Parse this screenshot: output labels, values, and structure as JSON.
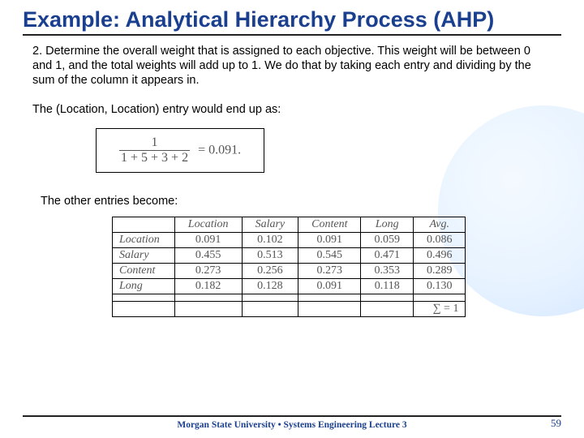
{
  "title": "Example: Analytical Hierarchy Process (AHP)",
  "para1": "2. Determine the overall weight that is assigned to each objective. This weight will be between 0 and 1, and the total weights will add up to 1. We do that by taking each entry and dividing by the sum of the column it appears in.",
  "para2": "The (Location, Location) entry would end up as:",
  "formula": {
    "numerator": "1",
    "denominator": "1 + 5 + 3 + 2",
    "rhs": "= 0.091."
  },
  "para3": "The other entries become:",
  "table": {
    "headers": [
      "",
      "Location",
      "Salary",
      "Content",
      "Long",
      "Avg."
    ],
    "rows": [
      [
        "Location",
        "0.091",
        "0.102",
        "0.091",
        "0.059",
        "0.086"
      ],
      [
        "Salary",
        "0.455",
        "0.513",
        "0.545",
        "0.471",
        "0.496"
      ],
      [
        "Content",
        "0.273",
        "0.256",
        "0.273",
        "0.353",
        "0.289"
      ],
      [
        "Long",
        "0.182",
        "0.128",
        "0.091",
        "0.118",
        "0.130"
      ]
    ],
    "sum_label": "∑ = 1"
  },
  "footer": "Morgan State University • Systems Engineering Lecture 3",
  "page": "59",
  "chart_data": {
    "type": "table",
    "title": "Normalized pairwise-comparison weights (AHP)",
    "columns": [
      "Location",
      "Salary",
      "Content",
      "Long",
      "Avg."
    ],
    "rows": [
      "Location",
      "Salary",
      "Content",
      "Long"
    ],
    "values": [
      [
        0.091,
        0.102,
        0.091,
        0.059,
        0.086
      ],
      [
        0.455,
        0.513,
        0.545,
        0.471,
        0.496
      ],
      [
        0.273,
        0.256,
        0.273,
        0.353,
        0.289
      ],
      [
        0.182,
        0.128,
        0.091,
        0.118,
        0.13
      ]
    ],
    "column_sum": 1
  }
}
